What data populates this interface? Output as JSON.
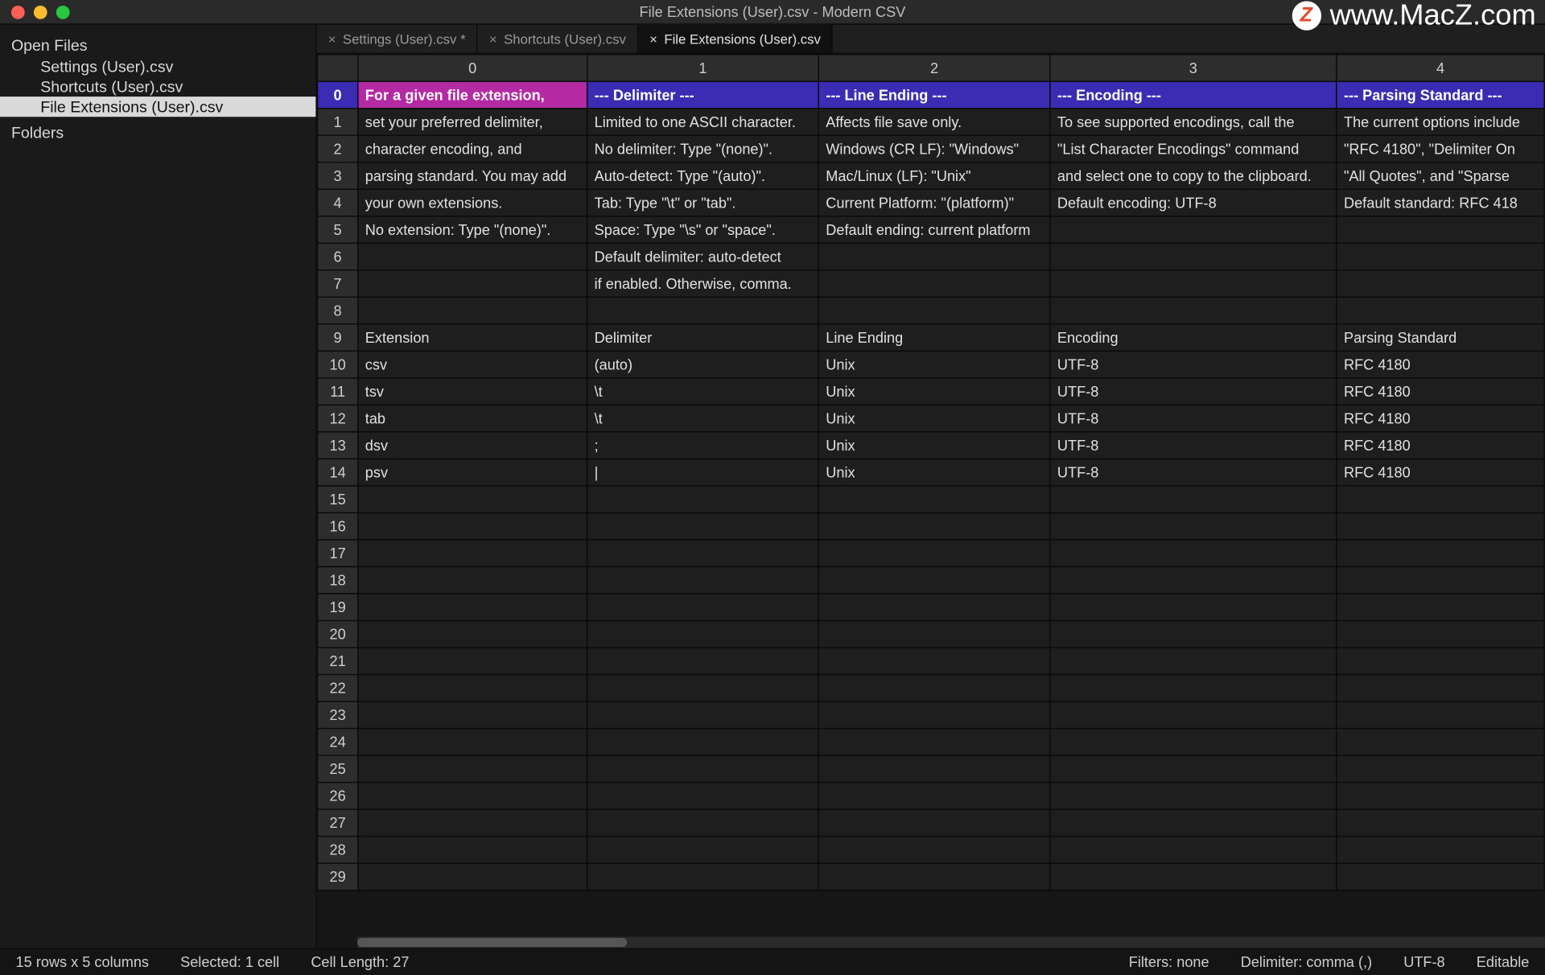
{
  "titlebar": {
    "title": "File Extensions (User).csv - Modern CSV"
  },
  "watermark": {
    "badge": "Z",
    "text": "www.MacZ.com"
  },
  "sidebar": {
    "open_files_label": "Open Files",
    "folders_label": "Folders",
    "files": [
      {
        "label": "Settings (User).csv"
      },
      {
        "label": "Shortcuts (User).csv"
      },
      {
        "label": "File Extensions (User).csv"
      }
    ]
  },
  "tabs": [
    {
      "label": "Settings (User).csv *",
      "active": false
    },
    {
      "label": "Shortcuts (User).csv",
      "active": false
    },
    {
      "label": "File Extensions (User).csv",
      "active": true
    }
  ],
  "grid": {
    "col_headers": [
      "0",
      "1",
      "2",
      "3",
      "4"
    ],
    "rows": [
      [
        "For a given file extension,",
        "--- Delimiter ---",
        "--- Line Ending ---",
        "--- Encoding ---",
        "--- Parsing Standard ---"
      ],
      [
        "set your preferred delimiter,",
        "Limited to one ASCII character.",
        "Affects file save only.",
        "To see supported encodings, call the",
        "The current options include"
      ],
      [
        "character encoding, and",
        "No delimiter: Type \"(none)\".",
        "Windows (CR LF): \"Windows\"",
        "\"List Character Encodings\" command",
        "\"RFC 4180\", \"Delimiter On"
      ],
      [
        "parsing standard. You may add",
        "Auto-detect: Type \"(auto)\".",
        "Mac/Linux (LF): \"Unix\"",
        "and select one to copy to the clipboard.",
        "\"All Quotes\", and \"Sparse "
      ],
      [
        "your own extensions.",
        "Tab: Type \"\\t\" or \"tab\".",
        "Current Platform: \"(platform)\"",
        "Default encoding: UTF-8",
        "Default standard: RFC 418"
      ],
      [
        "No extension: Type \"(none)\".",
        "Space: Type \"\\s\" or \"space\".",
        "Default ending: current platform",
        "",
        ""
      ],
      [
        "",
        "Default delimiter: auto-detect",
        "",
        "",
        ""
      ],
      [
        "",
        "if enabled. Otherwise, comma.",
        "",
        "",
        ""
      ],
      [
        "",
        "",
        "",
        "",
        ""
      ],
      [
        "Extension",
        "Delimiter",
        "Line Ending",
        "Encoding",
        "Parsing Standard"
      ],
      [
        "csv",
        "(auto)",
        "Unix",
        "UTF-8",
        "RFC 4180"
      ],
      [
        "tsv",
        "\\t",
        "Unix",
        "UTF-8",
        "RFC 4180"
      ],
      [
        "tab",
        "\\t",
        "Unix",
        "UTF-8",
        "RFC 4180"
      ],
      [
        "dsv",
        ";",
        "Unix",
        "UTF-8",
        "RFC 4180"
      ],
      [
        "psv",
        "|",
        "Unix",
        "UTF-8",
        "RFC 4180"
      ],
      [
        "",
        "",
        "",
        "",
        ""
      ],
      [
        "",
        "",
        "",
        "",
        ""
      ],
      [
        "",
        "",
        "",
        "",
        ""
      ],
      [
        "",
        "",
        "",
        "",
        ""
      ],
      [
        "",
        "",
        "",
        "",
        ""
      ],
      [
        "",
        "",
        "",
        "",
        ""
      ],
      [
        "",
        "",
        "",
        "",
        ""
      ],
      [
        "",
        "",
        "",
        "",
        ""
      ],
      [
        "",
        "",
        "",
        "",
        ""
      ],
      [
        "",
        "",
        "",
        "",
        ""
      ],
      [
        "",
        "",
        "",
        "",
        ""
      ],
      [
        "",
        "",
        "",
        "",
        ""
      ],
      [
        "",
        "",
        "",
        "",
        ""
      ],
      [
        "",
        "",
        "",
        "",
        ""
      ],
      [
        "",
        "",
        "",
        "",
        ""
      ]
    ],
    "row_numbers": [
      "0",
      "1",
      "2",
      "3",
      "4",
      "5",
      "6",
      "7",
      "8",
      "9",
      "10",
      "11",
      "12",
      "13",
      "14",
      "15",
      "16",
      "17",
      "18",
      "19",
      "20",
      "21",
      "22",
      "23",
      "24",
      "25",
      "26",
      "27",
      "28",
      "29"
    ]
  },
  "statusbar": {
    "dims": "15 rows x 5 columns",
    "selected": "Selected: 1 cell",
    "cell_len": "Cell Length: 27",
    "filters": "Filters: none",
    "delimiter": "Delimiter: comma (,)",
    "encoding": "UTF-8",
    "editable": "Editable"
  }
}
